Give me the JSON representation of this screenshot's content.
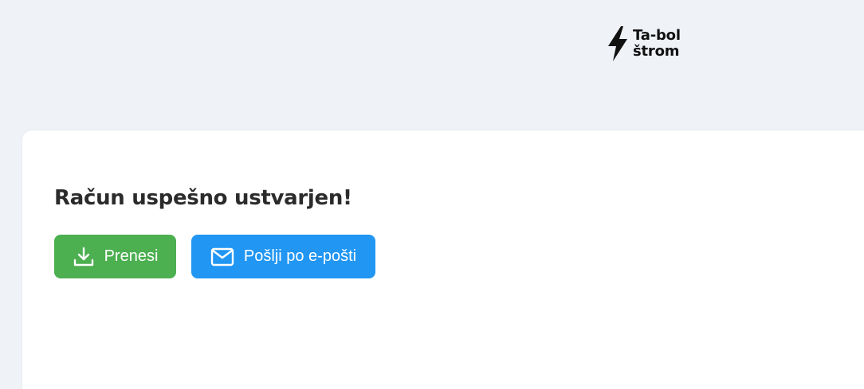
{
  "brand": {
    "line1": "Ta-bol",
    "line2": "štrom",
    "icon": "lightning-bolt-icon"
  },
  "card": {
    "title": "Račun uspešno ustvarjen!"
  },
  "actions": {
    "download": {
      "label": "Prenesi",
      "icon": "download-icon",
      "color": "#4caf50"
    },
    "email": {
      "label": "Pošlji po e-pošti",
      "icon": "envelope-icon",
      "color": "#2196f3"
    }
  },
  "colors": {
    "background": "#eff2f7",
    "card": "#ffffff",
    "text": "#2b2b2b"
  }
}
